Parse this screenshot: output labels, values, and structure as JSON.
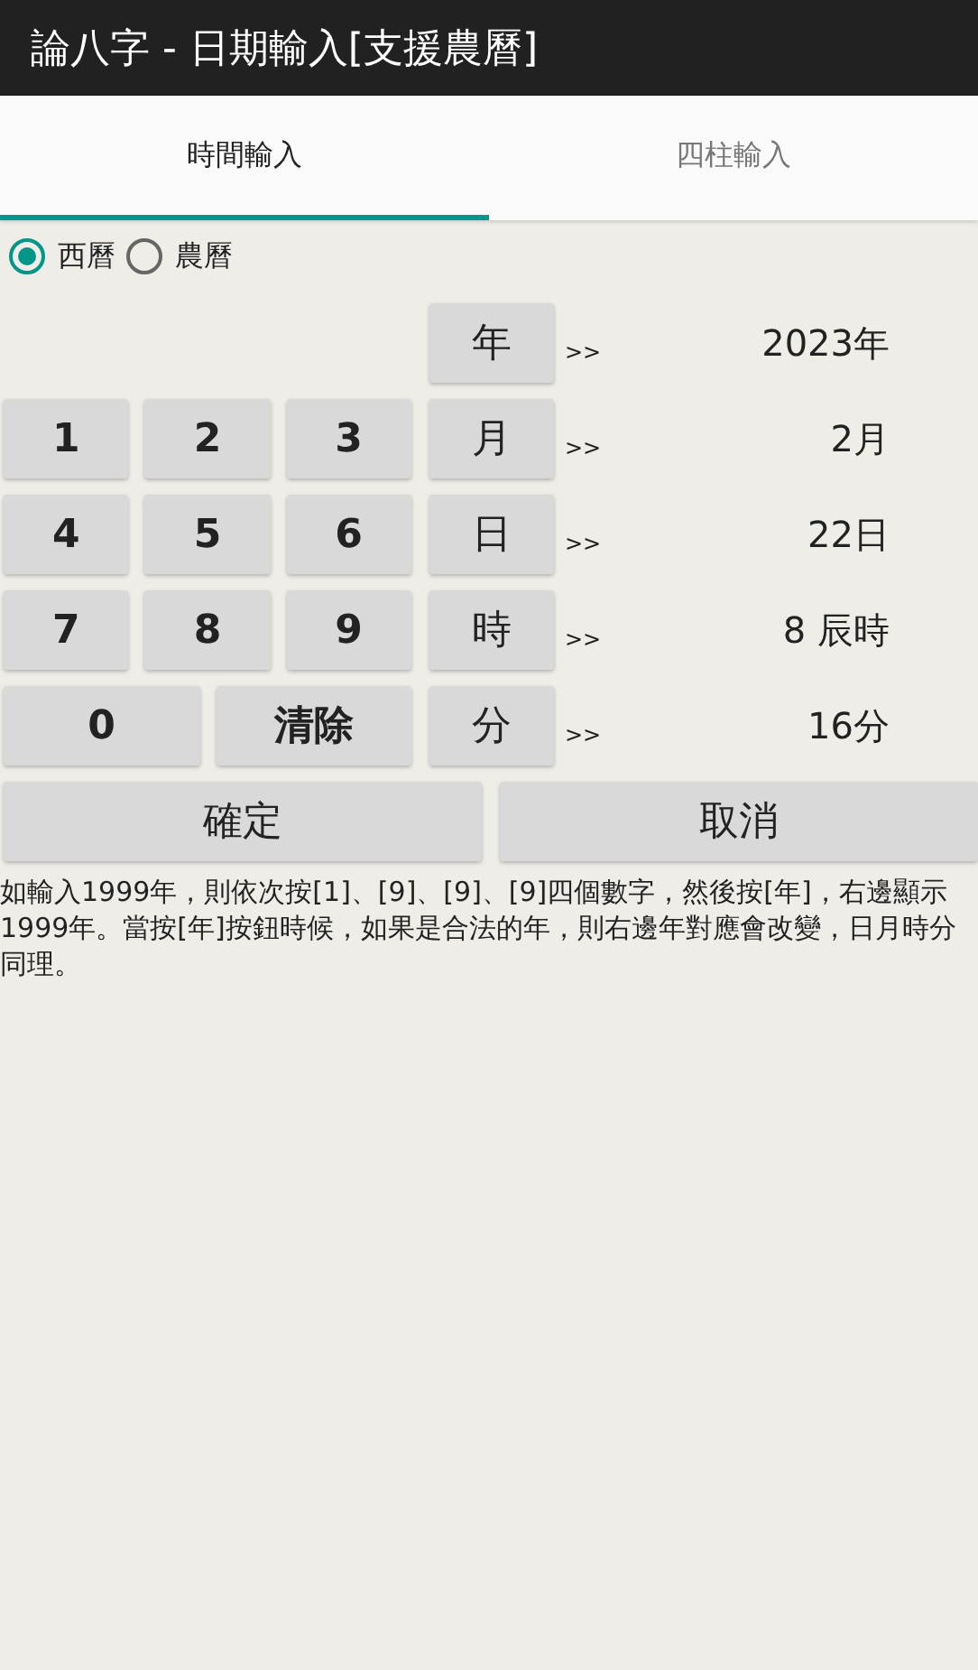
{
  "window": {
    "title": "論八字 - 日期輸入[支援農曆]"
  },
  "tabs": [
    {
      "label": "時間輸入",
      "selected": true
    },
    {
      "label": "四柱輸入",
      "selected": false
    }
  ],
  "calendar_options": [
    {
      "label": "西曆",
      "selected": true
    },
    {
      "label": "農曆",
      "selected": false
    }
  ],
  "rows": [
    {
      "keys": [],
      "unit": "年",
      "arrow": ">>",
      "value": "2023年"
    },
    {
      "keys": [
        "1",
        "2",
        "3"
      ],
      "unit": "月",
      "arrow": ">>",
      "value": "2月"
    },
    {
      "keys": [
        "4",
        "5",
        "6"
      ],
      "unit": "日",
      "arrow": ">>",
      "value": "22日"
    },
    {
      "keys": [
        "7",
        "8",
        "9"
      ],
      "unit": "時",
      "arrow": ">>",
      "value": "8 辰時"
    },
    {
      "keys": [
        "0",
        "清除"
      ],
      "unit": "分",
      "arrow": ">>",
      "value": "16分"
    }
  ],
  "actions": [
    "確定",
    "取消"
  ],
  "help_text": "如輸入1999年，則依次按[1]、[9]、[9]、[9]四個數字，然後按[年]，右邊顯示1999年。當按[年]按鈕時候，如果是合法的年，則右邊年對應會改變，日月時分同理。"
}
